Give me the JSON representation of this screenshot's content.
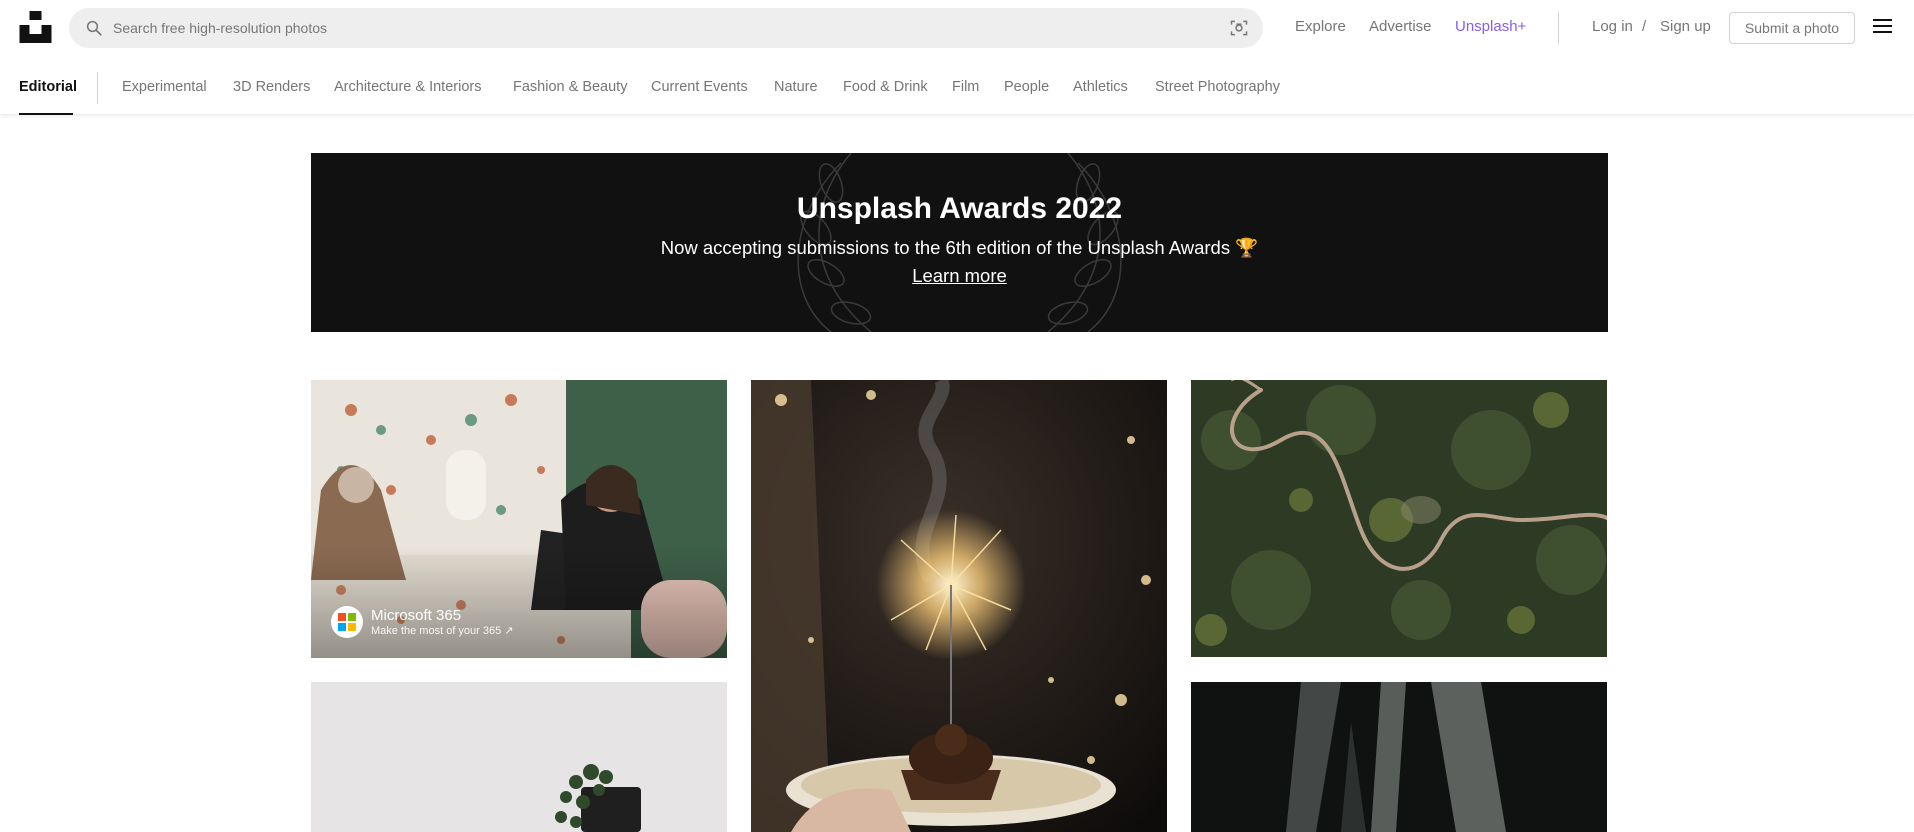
{
  "header": {
    "search_placeholder": "Search free high-resolution photos",
    "nav": [
      "Explore",
      "Advertise",
      "Unsplash+"
    ],
    "login": "Log in",
    "separator": "/",
    "signup": "Sign up",
    "submit": "Submit a photo"
  },
  "topics": {
    "active": "Editorial",
    "items": [
      "Experimental",
      "3D Renders",
      "Architecture & Interiors",
      "Fashion & Beauty",
      "Current Events",
      "Nature",
      "Food & Drink",
      "Film",
      "People",
      "Athletics",
      "Street Photography"
    ]
  },
  "banner": {
    "title": "Unsplash Awards 2022",
    "subtitle": "Now accepting submissions to the 6th edition of the Unsplash Awards 🏆",
    "link": "Learn more"
  },
  "photos": {
    "sponsored": {
      "name": "Microsoft 365",
      "tagline": "Make the most of your 365 ↗"
    }
  },
  "colors": {
    "accent_plus": "#8a5cf6",
    "banner_bg": "#111111",
    "muted_text": "#767676"
  }
}
